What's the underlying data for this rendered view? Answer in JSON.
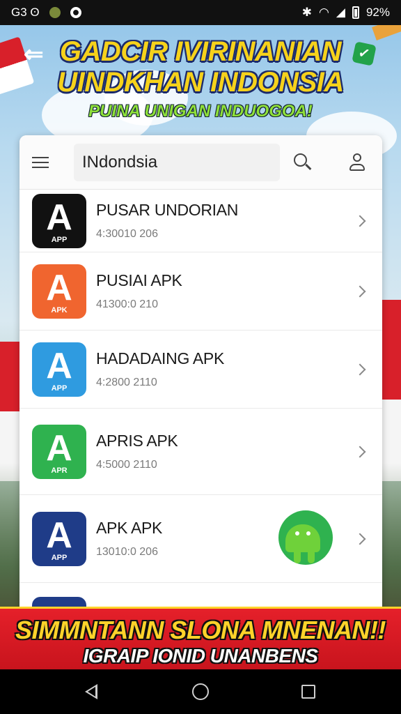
{
  "status_bar": {
    "left_text": "G3 ʘ",
    "battery_percent": "92%"
  },
  "header": {
    "back_icon": "arrow-left-icon",
    "title_line1": "GADCIR IVIRINANIAN",
    "title_line2": "UINDKHAN INDONSIA",
    "subtitle": "PUINA UNIGAN INDUOGOA!"
  },
  "search": {
    "value": "INdondsia"
  },
  "apps": [
    {
      "name": "PUSAR UNDORIAN",
      "sub": "4:30010 206",
      "color": "#111111",
      "icon_label": "APP"
    },
    {
      "name": "PUSIAI APK",
      "sub": "41300:0 210",
      "color": "#f0652f",
      "icon_label": "APK"
    },
    {
      "name": "HADADAING APK",
      "sub": "4:2800 2110",
      "color": "#2f9be0",
      "icon_label": "APP"
    },
    {
      "name": "APRIS APK",
      "sub": "4:5000 2110",
      "color": "#2fb24f",
      "icon_label": "APR"
    },
    {
      "name": "APK APK",
      "sub": "13010:0 206",
      "color": "#1f3c88",
      "icon_label": "APP"
    }
  ],
  "banner": {
    "line1": "SIMMNTANN SLONA MNENAN!!",
    "line2": "IGRAIP IONID UNANBENS"
  },
  "colors": {
    "title_yellow": "#f6d21b",
    "subtitle_green": "#8fe03a",
    "banner_red": "#e5202a"
  }
}
